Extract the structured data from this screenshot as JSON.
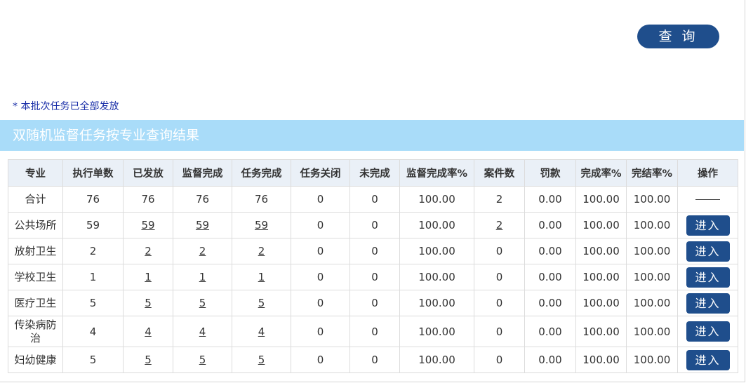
{
  "toolbar": {
    "query_label": "查 询"
  },
  "notice": "* 本批次任务已全部发放",
  "results_title": "双随机监督任务按专业查询结果",
  "table": {
    "headers": [
      "专业",
      "执行单数",
      "已发放",
      "监督完成",
      "任务完成",
      "任务关闭",
      "未完成",
      "监督完成率%",
      "案件数",
      "罚款",
      "完成率%",
      "完结率%",
      "操作"
    ],
    "rows": [
      {
        "name": "合计",
        "exec": "76",
        "issued": "76",
        "supervised": "76",
        "done": "76",
        "closed": "0",
        "unfinished": "0",
        "sup_rate": "100.00",
        "cases": "2",
        "fine": "0.00",
        "rate": "100.00",
        "close_rate": "100.00",
        "action": "——"
      },
      {
        "name": "公共场所",
        "exec": "59",
        "issued": "59",
        "supervised": "59",
        "done": "59",
        "closed": "0",
        "unfinished": "0",
        "sup_rate": "100.00",
        "cases": "2",
        "fine": "0.00",
        "rate": "100.00",
        "close_rate": "100.00",
        "action": "进入"
      },
      {
        "name": "放射卫生",
        "exec": "2",
        "issued": "2",
        "supervised": "2",
        "done": "2",
        "closed": "0",
        "unfinished": "0",
        "sup_rate": "100.00",
        "cases": "0",
        "fine": "0.00",
        "rate": "100.00",
        "close_rate": "100.00",
        "action": "进入"
      },
      {
        "name": "学校卫生",
        "exec": "1",
        "issued": "1",
        "supervised": "1",
        "done": "1",
        "closed": "0",
        "unfinished": "0",
        "sup_rate": "100.00",
        "cases": "0",
        "fine": "0.00",
        "rate": "100.00",
        "close_rate": "100.00",
        "action": "进入"
      },
      {
        "name": "医疗卫生",
        "exec": "5",
        "issued": "5",
        "supervised": "5",
        "done": "5",
        "closed": "0",
        "unfinished": "0",
        "sup_rate": "100.00",
        "cases": "0",
        "fine": "0.00",
        "rate": "100.00",
        "close_rate": "100.00",
        "action": "进入"
      },
      {
        "name": "传染病防治",
        "exec": "4",
        "issued": "4",
        "supervised": "4",
        "done": "4",
        "closed": "0",
        "unfinished": "0",
        "sup_rate": "100.00",
        "cases": "0",
        "fine": "0.00",
        "rate": "100.00",
        "close_rate": "100.00",
        "action": "进入"
      },
      {
        "name": "妇幼健康",
        "exec": "5",
        "issued": "5",
        "supervised": "5",
        "done": "5",
        "closed": "0",
        "unfinished": "0",
        "sup_rate": "100.00",
        "cases": "0",
        "fine": "0.00",
        "rate": "100.00",
        "close_rate": "100.00",
        "action": "进入"
      }
    ]
  },
  "colors": {
    "button": "#1f4e8c",
    "header_band": "#a9dcf9",
    "notice_text": "#1a2fa8",
    "table_header_bg": "#eaf0f7"
  }
}
